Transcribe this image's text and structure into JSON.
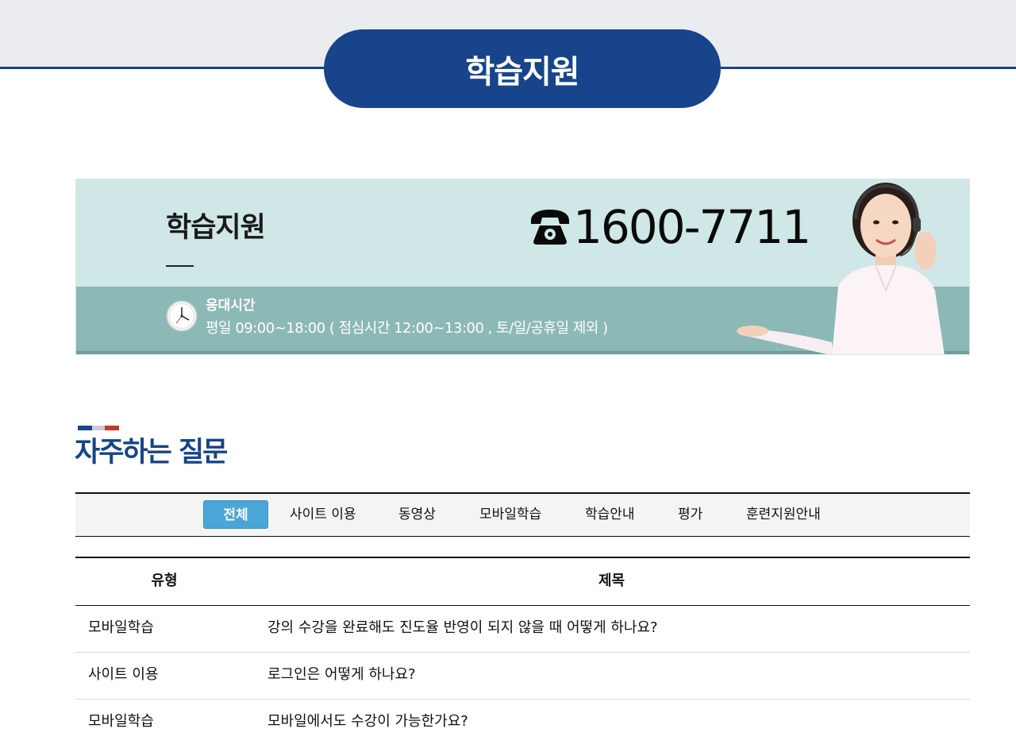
{
  "header": {
    "title": "학습지원"
  },
  "banner": {
    "title": "학습지원",
    "phone": "1600-7711",
    "hours_label": "응대시간",
    "hours_text": "평일 09:00~18:00 ( 점심시간 12:00~13:00 , 토/일/공휴일 제외 )"
  },
  "faq": {
    "title": "자주하는 질문",
    "tabs": [
      {
        "label": "전체",
        "active": true
      },
      {
        "label": "사이트 이용",
        "active": false
      },
      {
        "label": "동영상",
        "active": false
      },
      {
        "label": "모바일학습",
        "active": false
      },
      {
        "label": "학습안내",
        "active": false
      },
      {
        "label": "평가",
        "active": false
      },
      {
        "label": "훈련지원안내",
        "active": false
      }
    ],
    "columns": {
      "type": "유형",
      "subject": "제목"
    },
    "rows": [
      {
        "type": "모바일학습",
        "subject": "강의 수강을 완료해도 진도율 반영이 되지 않을 때 어떻게 하나요?"
      },
      {
        "type": "사이트 이용",
        "subject": "로그인은 어떻게 하나요?"
      },
      {
        "type": "모바일학습",
        "subject": "모바일에서도 수강이 가능한가요?"
      }
    ]
  },
  "colors": {
    "brand_navy": "#17448a",
    "tab_active": "#4ba6d8",
    "banner_light": "#d0e7e7",
    "banner_dark": "#8cb8b6"
  },
  "icons": [
    "telephone-icon",
    "clock-icon"
  ]
}
